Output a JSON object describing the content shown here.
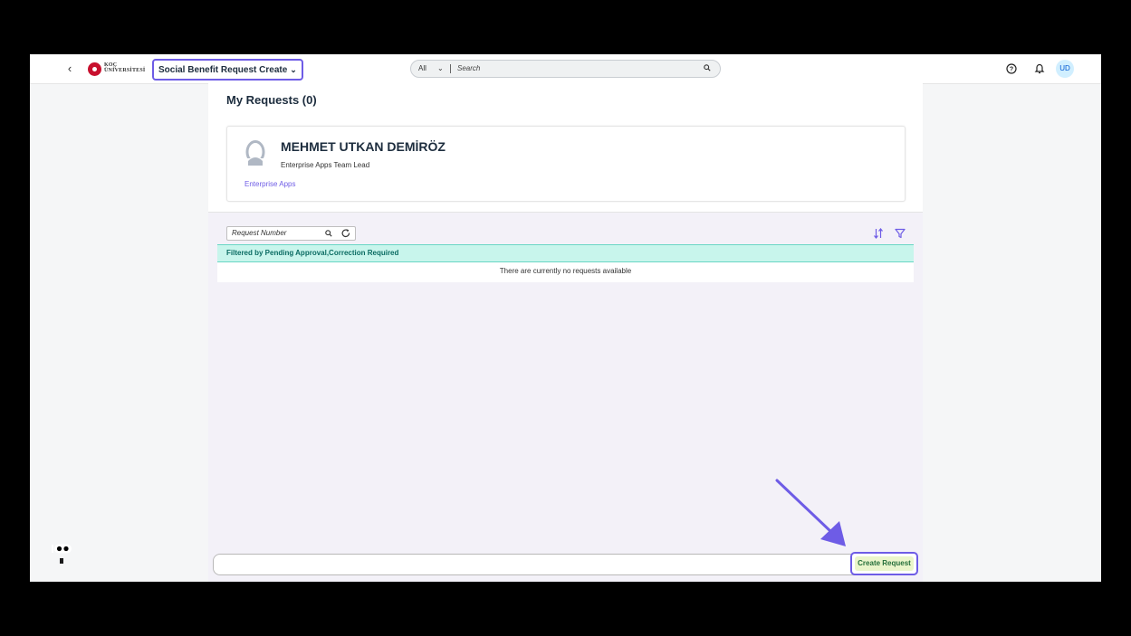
{
  "shell": {
    "logo_line1": "KOÇ",
    "logo_line2": "ÜNİVERSİTESİ",
    "app_title": "Social Benefit Request Create",
    "search_scope": "All",
    "search_placeholder": "Search",
    "avatar_initials": "UD"
  },
  "page": {
    "title": "My Requests (0)"
  },
  "profile": {
    "name": "MEHMET UTKAN DEMİRÖZ",
    "role": "Enterprise Apps Team Lead",
    "department": "Enterprise Apps"
  },
  "list": {
    "search_placeholder": "Request Number",
    "filter_text": "Filtered by Pending Approval,Correction Required",
    "empty_text": "There are currently no requests available"
  },
  "footer": {
    "create_label": "Create Request"
  },
  "colors": {
    "accent": "#6e5ce6",
    "filter_bg": "#c8f5ec",
    "create_bg": "#ebf5cb",
    "brand_red": "#c8102e"
  },
  "icons": [
    "back-icon",
    "logo",
    "chevron-down-icon",
    "search-icon",
    "help-icon",
    "bell-icon",
    "person-icon",
    "refresh-icon",
    "sort-icon",
    "filter-icon",
    "arrow-annotation"
  ]
}
